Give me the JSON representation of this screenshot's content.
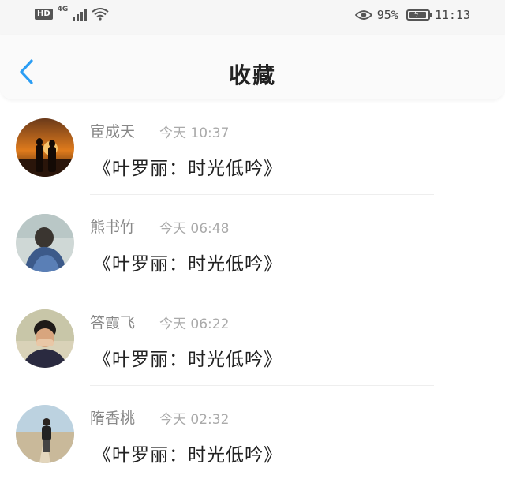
{
  "status_bar": {
    "hd": "HD",
    "network": "4G",
    "battery_percent": "95%",
    "time": "11:13",
    "battery_level": 0.95
  },
  "navbar": {
    "title": "收藏",
    "back_icon": "chevron-left-icon",
    "accent_color": "#2a9df4"
  },
  "favorites": [
    {
      "name": "宦成天",
      "time": "今天 10:37",
      "content": "《叶罗丽：时光低吟》",
      "avatar": "sunset-couple"
    },
    {
      "name": "熊书竹",
      "time": "今天 06:48",
      "content": "《叶罗丽：时光低吟》",
      "avatar": "person-blue-coat"
    },
    {
      "name": "答霞飞",
      "time": "今天 06:22",
      "content": "《叶罗丽：时光低吟》",
      "avatar": "boy-covering-face"
    },
    {
      "name": "隋香桃",
      "time": "今天 02:32",
      "content": "《叶罗丽：时光低吟》",
      "avatar": "backpacker-road"
    }
  ]
}
